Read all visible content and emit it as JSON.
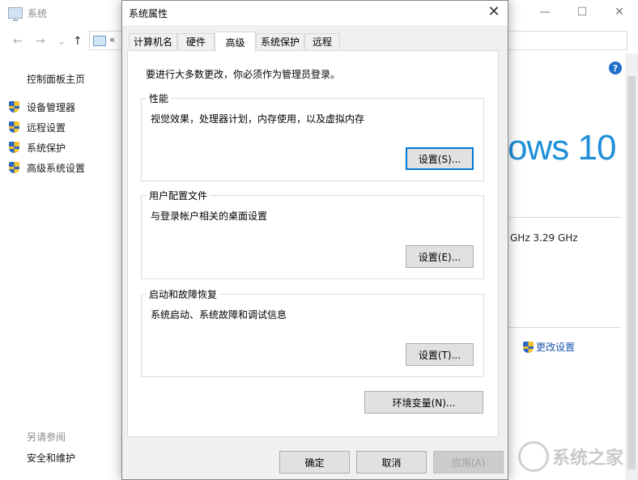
{
  "background_window": {
    "title": "系统",
    "controls": {
      "minimize": "—",
      "maximize": "☐",
      "close": "✕"
    },
    "nav": {
      "back": "←",
      "forward": "→",
      "up": "↑"
    },
    "address_chevron": "«",
    "sidebar": {
      "home": "控制面板主页",
      "items": [
        {
          "label": "设备管理器"
        },
        {
          "label": "远程设置"
        },
        {
          "label": "系统保护"
        },
        {
          "label": "高级系统设置"
        }
      ],
      "see_also": "另请参阅",
      "security": "安全和维护"
    },
    "help_icon": "?",
    "windows_logo_text": "ows 10",
    "cpu_text": "GHz   3.29 GHz",
    "change_settings": "更改设置",
    "watermark": "系统之家"
  },
  "dialog": {
    "title": "系统属性",
    "close": "✕",
    "tabs": [
      {
        "label": "计算机名"
      },
      {
        "label": "硬件"
      },
      {
        "label": "高级",
        "active": true
      },
      {
        "label": "系统保护"
      },
      {
        "label": "远程"
      }
    ],
    "notice": "要进行大多数更改，你必须作为管理员登录。",
    "groups": [
      {
        "title": "性能",
        "description": "视觉效果，处理器计划，内存使用，以及虚拟内存",
        "button": "设置(S)..."
      },
      {
        "title": "用户配置文件",
        "description": "与登录帐户相关的桌面设置",
        "button": "设置(E)..."
      },
      {
        "title": "启动和故障恢复",
        "description": "系统启动、系统故障和调试信息",
        "button": "设置(T)..."
      }
    ],
    "env_button": "环境变量(N)...",
    "footer": {
      "ok": "确定",
      "cancel": "取消",
      "apply": "应用(A)"
    }
  }
}
